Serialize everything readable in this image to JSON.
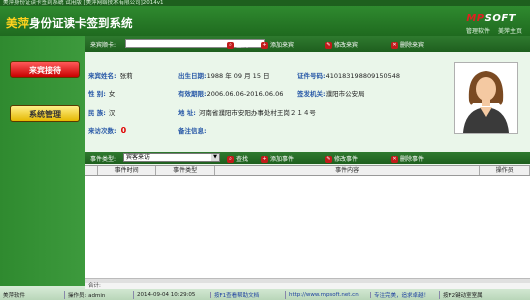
{
  "window": {
    "title": "美萍身份证读卡签到系统 试用版 [美萍网络技术有限公司]2014v1"
  },
  "header": {
    "title_accent": "美萍",
    "title_rest": "身份证读卡签到系统",
    "logo_prefix": "MP",
    "logo_suffix": "SOFT",
    "links": [
      "管理软件",
      "美萍主页"
    ]
  },
  "sidebar": {
    "items": [
      {
        "label": "来宾接待"
      },
      {
        "label": "系统管理"
      }
    ]
  },
  "search": {
    "label": "来宾顺卡:",
    "value": "",
    "buttons": [
      "查找",
      "添加来宾",
      "修改来宾",
      "删除来宾"
    ]
  },
  "visitor": {
    "name_label": "来宾姓名:",
    "name": "张莉",
    "birth_label": "出生日期:",
    "birth": "1988 年 09 月 15 日",
    "idno_label": "证件号码:",
    "idno": "410183198809150548",
    "gender_label": "性     别:",
    "gender": "女",
    "validity_label": "有效期限:",
    "validity": "2006.06.06-2016.06.06",
    "authority_label": "签发机关:",
    "authority": "濮阳市公安局",
    "ethnic_label": "民     族:",
    "ethnic": "汉",
    "address_label": "地     址:",
    "address": "河南省濮阳市安阳办事处村王岗２１４号",
    "visits_label": "来访次数:",
    "visits": "0",
    "remarks_label": "备注信息:",
    "remarks": ""
  },
  "events": {
    "type_label": "事件类型:",
    "type_value": "宾客来访",
    "buttons": [
      "查找",
      "添加事件",
      "修改事件",
      "删除事件"
    ],
    "columns": [
      "事件时间",
      "事件类型",
      "事件内容",
      "操作员"
    ],
    "total_label": "合计:"
  },
  "status": {
    "items": [
      "美萍软件",
      "操作员: admin",
      "2014-09-04 10:29:05",
      "按F1查看帮助文档",
      "http://www.mpsoft.net.cn",
      "专注完美，追求卓越！",
      "按F2键动室室属"
    ]
  },
  "colors": {
    "header_green": "#1f6a1f",
    "accent_yellow": "#ffd21e",
    "label_blue": "#2a5aa8",
    "count_red": "#e00000"
  }
}
